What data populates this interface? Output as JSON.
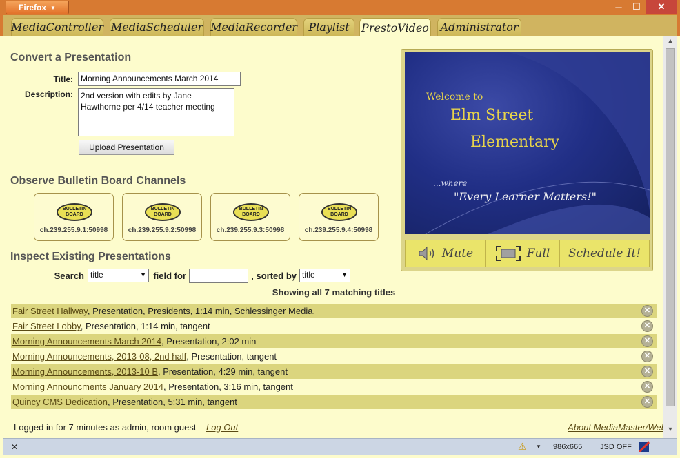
{
  "browser": {
    "app_button": "Firefox",
    "zoom_readout": "986x665",
    "jsd_status": "JSD OFF"
  },
  "tabs": [
    "MediaController",
    "MediaScheduler",
    "MediaRecorder",
    "Playlist",
    "PrestoVideo",
    "Administrator"
  ],
  "convert": {
    "heading": "Convert a Presentation",
    "title_label": "Title:",
    "title_value": "Morning Announcements March 2014",
    "description_label": "Description:",
    "description_value": "2nd version with edits by Jane Hawthorne per 4/14 teacher meeting",
    "upload_button": "Upload Presentation"
  },
  "observe": {
    "heading": "Observe Bulletin Board Channels",
    "logo_text_1": "BULLETIN",
    "logo_text_2": "BOARD",
    "channels": [
      "ch.239.255.9.1:50998",
      "ch.239.255.9.2:50998",
      "ch.239.255.9.3:50998",
      "ch.239.255.9.4:50998"
    ]
  },
  "inspect": {
    "heading": "Inspect Existing Presentations",
    "search_label": "Search",
    "search_by": "title",
    "field_for_label": "field for",
    "field_value": "",
    "sorted_by_label": ", sorted by",
    "sort_by": "title",
    "showing": "Showing all 7 matching titles",
    "rows": [
      {
        "title": "Fair Street Hallway",
        "details": ", Presentation, Presidents, 1:14 min, Schlessinger Media,"
      },
      {
        "title": "Fair Street Lobby",
        "details": ", Presentation, 1:14 min, tangent"
      },
      {
        "title": "Morning Announcements March 2014",
        "details": ", Presentation, 2:02 min"
      },
      {
        "title": "Morning Announcements, 2013-08, 2nd half",
        "details": ", Presentation, tangent"
      },
      {
        "title": "Morning Announcements, 2013-10 B",
        "details": ", Presentation, 4:29 min, tangent"
      },
      {
        "title": "Morning Announcments January 2014",
        "details": ", Presentation, 3:16 min, tangent"
      },
      {
        "title": "Quincy CMS Dedication",
        "details": ", Presentation, 5:31 min, tangent"
      }
    ]
  },
  "preview": {
    "welcome": "Welcome to",
    "school_1": "Elm Street",
    "school_2": "Elementary",
    "where": "...where",
    "motto": "\"Every Learner Matters!\"",
    "mute": "Mute",
    "full": "Full",
    "schedule": "Schedule It!"
  },
  "footer": {
    "status": "Logged in for 7 minutes as admin, room guest",
    "logout": "Log Out",
    "about": "About MediaMaster/Web"
  },
  "colors": {
    "accent": "#d77a32",
    "background": "#fdfccc",
    "row_highlight": "#dbd57e",
    "slide_blue": "#212f86",
    "slide_text": "#e8d44a"
  }
}
